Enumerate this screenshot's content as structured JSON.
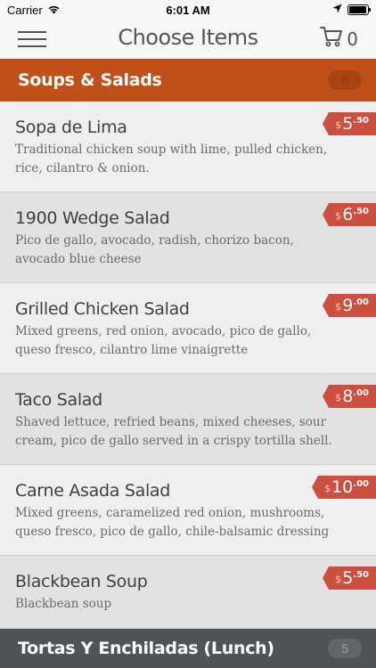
{
  "status_bar": {
    "carrier": "Carrier",
    "time": "6:01 AM",
    "battery_level": 0.95
  },
  "nav": {
    "title": "Choose Items",
    "cart_count": "0",
    "menu_icon": "hamburger-icon",
    "cart_icon": "cart-icon"
  },
  "sections": [
    {
      "title": "Soups & Salads",
      "count": "6",
      "color": "#c0501a"
    },
    {
      "title": "Tortas Y Enchiladas (Lunch)",
      "count": "5",
      "color": "#4f5459"
    }
  ],
  "items": [
    {
      "name": "Sopa de Lima",
      "description": "Traditional chicken soup with lime, pulled chicken, rice, cilantro & onion.",
      "price": {
        "dollar": "$",
        "main": "5",
        "cents": ".50"
      }
    },
    {
      "name": "1900 Wedge Salad",
      "description": "Pico de gallo, avocado, radish, chorizo bacon, avocado blue cheese",
      "price": {
        "dollar": "$",
        "main": "6",
        "cents": ".50"
      }
    },
    {
      "name": "Grilled Chicken Salad",
      "description": "Mixed greens, red onion, avocado, pico de gallo, queso fresco, cilantro lime vinaigrette",
      "price": {
        "dollar": "$",
        "main": "9",
        "cents": ".00"
      }
    },
    {
      "name": "Taco Salad",
      "description": "Shaved lettuce, refried beans, mixed cheeses, sour cream, pico de gallo served in a crispy tortilla shell.",
      "price": {
        "dollar": "$",
        "main": "8",
        "cents": ".00"
      }
    },
    {
      "name": "Carne Asada Salad",
      "description": "Mixed greens, caramelized red onion, mushrooms, queso fresco, pico de gallo, chile-balsamic dressing",
      "price": {
        "dollar": "$",
        "main": "10",
        "cents": ".00"
      }
    },
    {
      "name": "Blackbean Soup",
      "description": "Blackbean soup",
      "price": {
        "dollar": "$",
        "main": "5",
        "cents": ".50"
      }
    }
  ],
  "colors": {
    "price_tag": "#cc4f3f",
    "accent_orange": "#c0501a",
    "section_dark": "#4f5459"
  }
}
